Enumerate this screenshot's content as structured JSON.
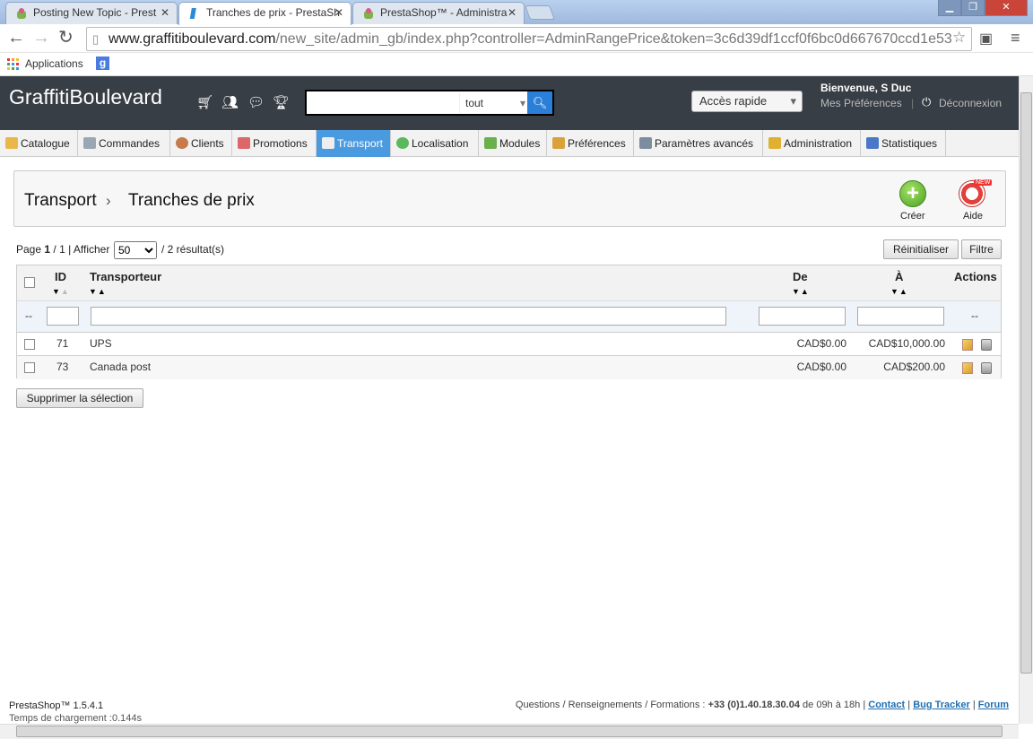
{
  "browser": {
    "tabs": [
      {
        "title": "Posting New Topic - Prest"
      },
      {
        "title": "Tranches de prix - PrestaSh"
      },
      {
        "title": "PrestaShop™ - Administra"
      }
    ],
    "url_host": "www.graffitiboulevard.com",
    "url_rest": "/new_site/admin_gb/index.php?controller=AdminRangePrice&token=3c6d39df1ccf0f6bc0d667670ccd1e53",
    "bookmarks": {
      "apps_label": "Applications"
    }
  },
  "header": {
    "logo": "GraffitiBoulevard",
    "search_scope": "tout",
    "quick_access": "Accès rapide",
    "welcome": "Bienvenue, S Duc",
    "preferences": "Mes Préférences",
    "logout": "Déconnexion"
  },
  "menu": [
    {
      "label": "Catalogue",
      "icon_color": "#e8b84a"
    },
    {
      "label": "Commandes",
      "icon_color": "#9aa7b3"
    },
    {
      "label": "Clients",
      "icon_color": "#c77b4a"
    },
    {
      "label": "Promotions",
      "icon_color": "#d66"
    },
    {
      "label": "Transport",
      "icon_color": "#eee"
    },
    {
      "label": "Localisation",
      "icon_color": "#5cb85c"
    },
    {
      "label": "Modules",
      "icon_color": "#6ab04c"
    },
    {
      "label": "Préférences",
      "icon_color": "#d9a23b"
    },
    {
      "label": "Paramètres avancés",
      "icon_color": "#7c8da0"
    },
    {
      "label": "Administration",
      "icon_color": "#e0b030"
    },
    {
      "label": "Statistiques",
      "icon_color": "#4a78c8"
    }
  ],
  "page": {
    "breadcrumb_parent": "Transport",
    "breadcrumb_sep": "›",
    "title": "Tranches de prix",
    "create_label": "Créer",
    "help_label": "Aide"
  },
  "pagination": {
    "prefix": "Page",
    "current": "1",
    "total": "/ 1",
    "show_label": "| Afficher",
    "per_page": "50",
    "results": "/ 2 résultat(s)",
    "reset_label": "Réinitialiser",
    "filter_label": "Filtre"
  },
  "table": {
    "headers": {
      "id": "ID",
      "carrier": "Transporteur",
      "from": "De",
      "to": "À",
      "actions": "Actions"
    },
    "filter_empty": "--",
    "rows": [
      {
        "id": "71",
        "carrier": "UPS",
        "from": "CAD$0.00",
        "to": "CAD$10,000.00"
      },
      {
        "id": "73",
        "carrier": "Canada post",
        "from": "CAD$0.00",
        "to": "CAD$200.00"
      }
    ]
  },
  "bulk_delete_label": "Supprimer la sélection",
  "footer": {
    "version": "PrestaShop™ 1.5.4.1",
    "load_time": "Temps de chargement :0.144s",
    "contact_text": "Questions / Renseignements / Formations :",
    "phone": "+33 (0)1.40.18.30.04",
    "hours": "de 09h à 18h |",
    "contact_link": "Contact",
    "bug_link": "Bug Tracker",
    "forum_link": "Forum"
  }
}
